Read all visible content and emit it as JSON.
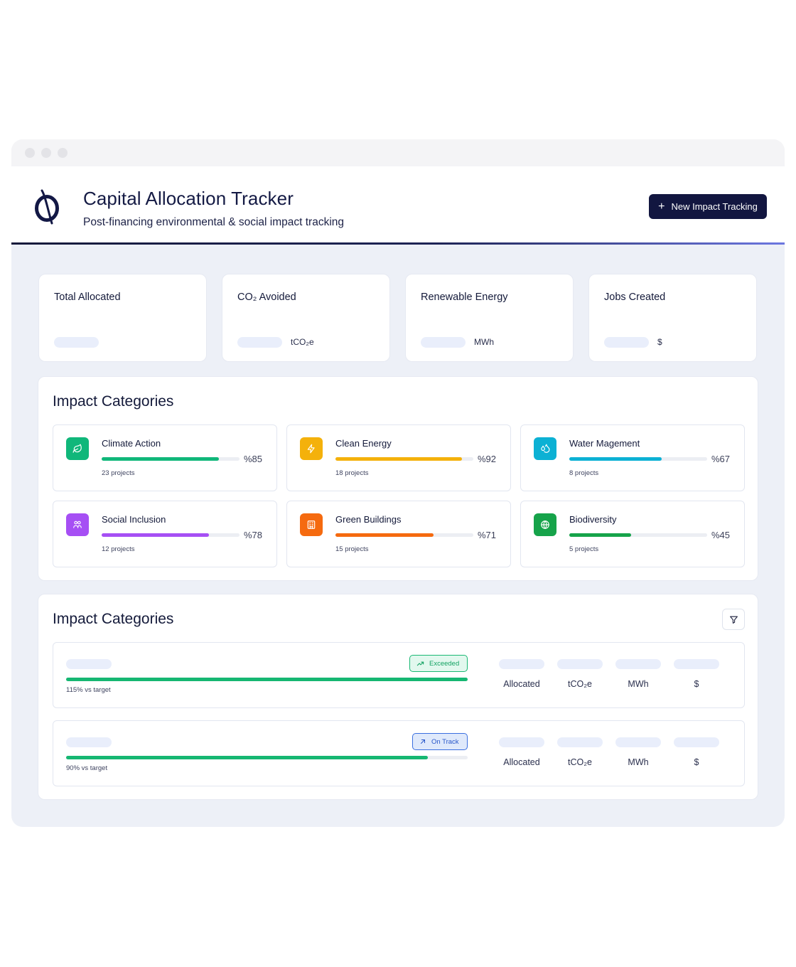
{
  "app": {
    "title": "Capital Allocation Tracker",
    "subtitle": "Post-financing environmental & social impact tracking",
    "new_button_label": "New Impact Tracking",
    "new_button_icon": "+"
  },
  "kpis": [
    {
      "label": "Total Allocated",
      "unit": ""
    },
    {
      "label": "CO₂ Avoided",
      "unit": "tCO₂e"
    },
    {
      "label": "Renewable Energy",
      "unit": "MWh"
    },
    {
      "label": "Jobs Created",
      "unit": "$"
    }
  ],
  "categories_section": {
    "title": "Impact Categories",
    "items": [
      {
        "name": "Climate Action",
        "percent_text": "%85",
        "progress": 0.85,
        "projects": "23 projects",
        "color": "#10b77a",
        "icon": "leaf-icon"
      },
      {
        "name": "Clean Energy",
        "percent_text": "%92",
        "progress": 0.92,
        "projects": "18 projects",
        "color": "#f4b10b",
        "icon": "lightning-icon"
      },
      {
        "name": "Water Magement",
        "percent_text": "%67",
        "progress": 0.67,
        "projects": "8 projects",
        "color": "#0cb1d4",
        "icon": "droplet-icon"
      },
      {
        "name": "Social Inclusion",
        "percent_text": "%78",
        "progress": 0.78,
        "projects": "12 projects",
        "color": "#a64ff4",
        "icon": "people-icon"
      },
      {
        "name": "Green Buildings",
        "percent_text": "%71",
        "progress": 0.71,
        "projects": "15 projects",
        "color": "#f56a0f",
        "icon": "building-icon"
      },
      {
        "name": "Biodiversity",
        "percent_text": "%45",
        "progress": 0.45,
        "projects": "5 projects",
        "color": "#16a34a",
        "icon": "globe-icon"
      }
    ]
  },
  "projects_section": {
    "title": "Impact Categories",
    "filter_icon": "filter-icon",
    "rows": [
      {
        "status": "Exceeded",
        "status_icon": "trend-up-icon",
        "progress": 1.0,
        "vs_target": "115% vs target",
        "metrics": [
          "Allocated",
          "tCO₂e",
          "MWh",
          "$"
        ]
      },
      {
        "status": "On Track",
        "status_icon": "arrow-up-right-icon",
        "progress": 0.9,
        "vs_target": "90% vs target",
        "metrics": [
          "Allocated",
          "tCO₂e",
          "MWh",
          "$"
        ]
      }
    ]
  }
}
